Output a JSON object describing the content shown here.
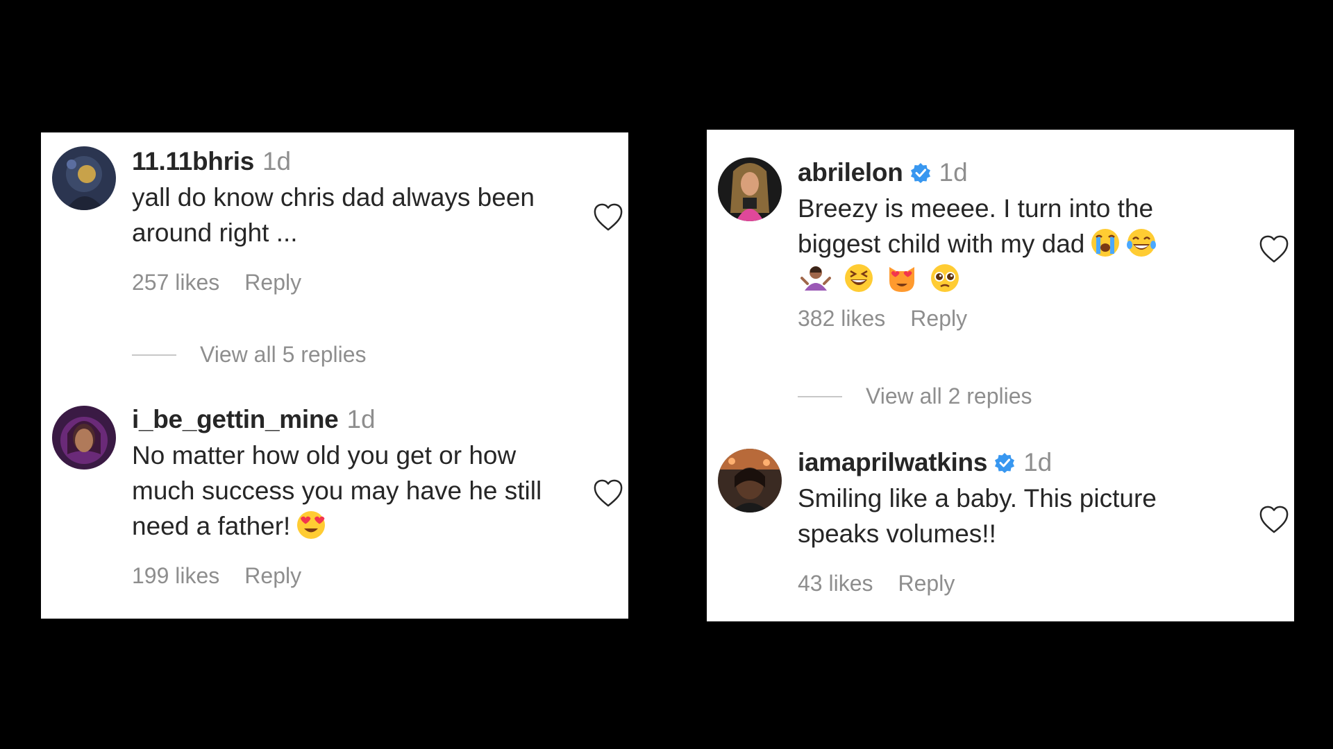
{
  "left_panel": {
    "comment1": {
      "username": "11.11bhris",
      "time": "1d",
      "text": "yall do know chris dad always been\naround right ...",
      "likes": "257 likes",
      "reply": "Reply"
    },
    "view_replies": "View all 5 replies",
    "comment2": {
      "username": "i_be_gettin_mine",
      "time": "1d",
      "text": "No matter how old you get or how\nmuch success you may have he still\nneed a father!",
      "likes": "199 likes",
      "reply": "Reply"
    }
  },
  "right_panel": {
    "comment1": {
      "username": "abrilelon",
      "time": "1d",
      "text": "Breezy is meeee. I turn into the\nbiggest child with my dad",
      "likes": "382 likes",
      "reply": "Reply"
    },
    "view_replies": "View all 2 replies",
    "comment2": {
      "username": "iamaprilwatkins",
      "time": "1d",
      "text": "Smiling like a baby. This picture\nspeaks volumes!!",
      "likes": "43 likes",
      "reply": "Reply"
    }
  },
  "icons": {
    "heart": "heart-outline-icon",
    "verified": "verified-badge-icon",
    "verified_color": "#3897f0"
  }
}
